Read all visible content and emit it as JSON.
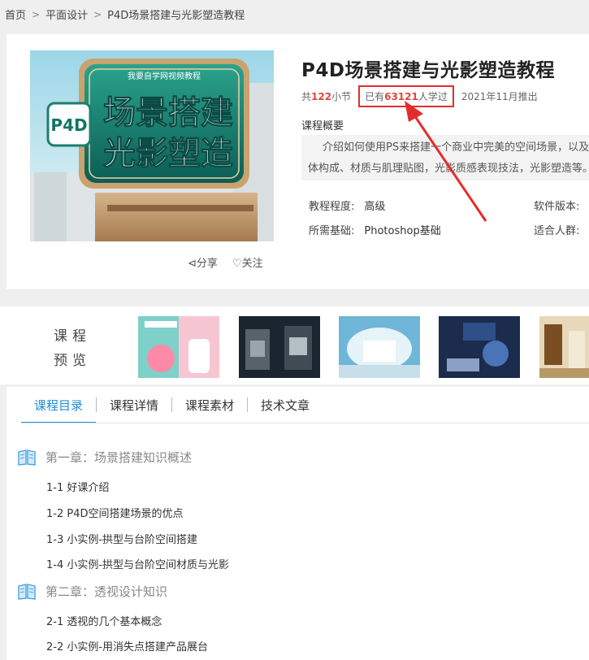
{
  "breadcrumb": {
    "items": [
      "首页",
      "平面设计",
      "P4D场景搭建与光影塑造教程"
    ]
  },
  "course": {
    "title": "P4D场景搭建与光影塑造教程",
    "lessons_prefix": "共",
    "lessons_count": "122",
    "lessons_suffix": "小节",
    "learned_prefix": "已有",
    "learned_count": "63121",
    "learned_suffix": "人学过",
    "release": "2021年11月推出",
    "overview_label": "课程概要",
    "overview_line1": "介绍如何使用PS来搭建一个商业中完美的空间场景，以及",
    "overview_line2": "体构成、材质与肌理贴图，光影质感表现技法，光影塑造等。",
    "level_label": "教程程度:",
    "level_value": "高级",
    "software_label": "软件版本:",
    "basis_label": "所需基础:",
    "basis_value": "Photoshop基础",
    "audience_label": "适合人群:",
    "share_label": "分享",
    "follow_label": "关注",
    "cover": {
      "top_text": "我要自学网视频教程",
      "badge": "P4D",
      "line1": "场景搭建",
      "line2": "光影塑造"
    }
  },
  "preview": {
    "label_line1": "课程",
    "label_line2": "预览"
  },
  "tabs": [
    {
      "label": "课程目录"
    },
    {
      "label": "课程详情"
    },
    {
      "label": "课程素材"
    },
    {
      "label": "技术文章"
    }
  ],
  "chapters": [
    {
      "title": "第一章：场景搭建知识概述",
      "lessons": [
        "1-1 好课介绍",
        "1-2 P4D空间搭建场景的优点",
        "1-3 小实例-拱型与台阶空间搭建",
        "1-4 小实例-拱型与台阶空间材质与光影"
      ]
    },
    {
      "title": "第二章：透视设计知识",
      "lessons": [
        "2-1 透视的几个基本概念",
        "2-2 小实例-用消失点搭建产品展台"
      ]
    }
  ],
  "colors": {
    "accent": "#1f8fd6",
    "highlight": "#e3433a",
    "annotation": "#e52c2c"
  }
}
